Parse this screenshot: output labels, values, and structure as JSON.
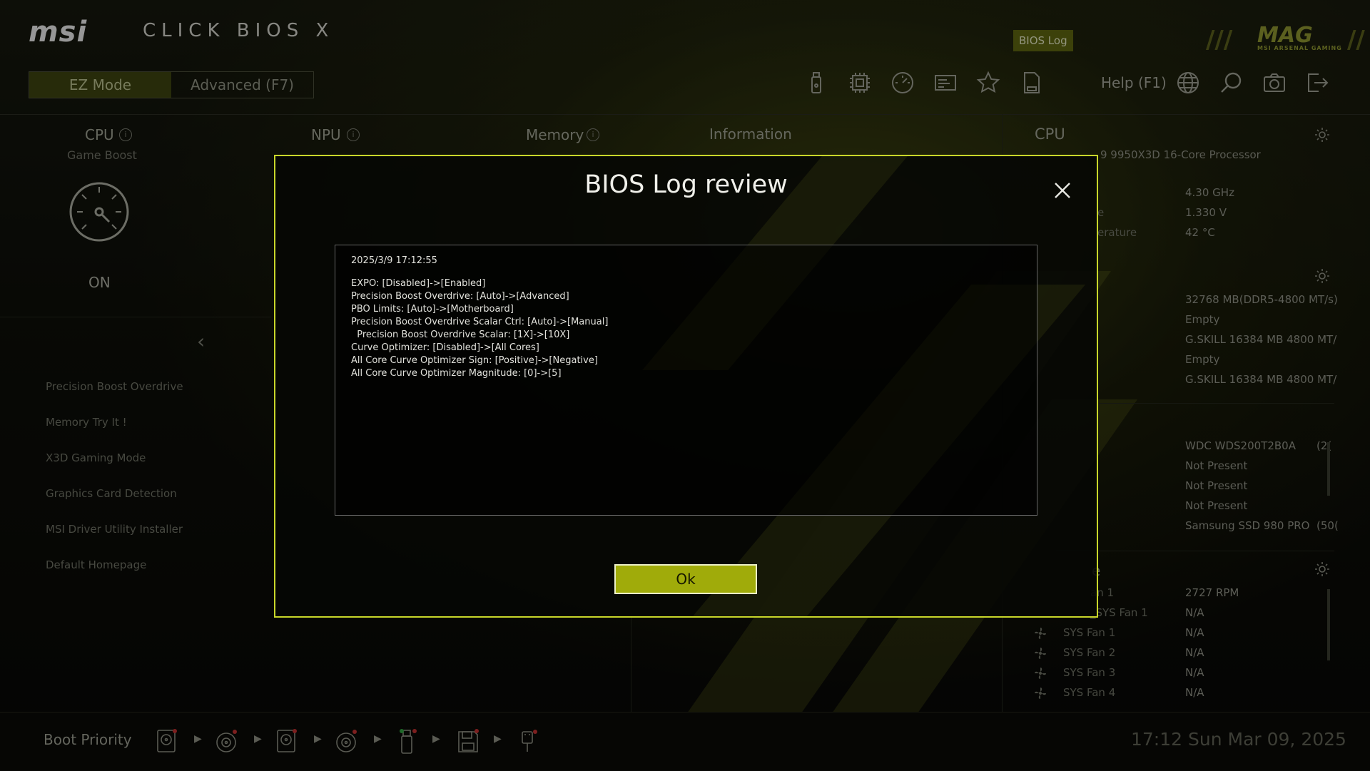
{
  "brand": {
    "logo": "msi",
    "product": "CLICK BIOS X",
    "mag_logo": "MAG",
    "mag_tag": "MSI ARSENAL GAMING"
  },
  "header": {
    "bios_log_label": "BIOS Log",
    "mode_tabs": [
      "EZ Mode",
      "Advanced (F7)"
    ],
    "active_mode": "EZ Mode",
    "help_label": "Help (F1)",
    "toolbar_icons": [
      "usb-drive-icon",
      "cpu-chip-icon",
      "oc-gauge-icon",
      "hardware-monitor-icon",
      "favorites-star-icon",
      "log-file-icon",
      "language-globe-icon",
      "search-icon",
      "screenshot-camera-icon",
      "exit-icon"
    ]
  },
  "left": {
    "cpu_title": "CPU",
    "cpu_sub": "Game Boost",
    "game_boost_state": "ON",
    "npu_title": "NPU",
    "memory_title": "Memory",
    "information_title": "Information",
    "menu": [
      "Precision Boost Overdrive",
      "Memory Try It !",
      "X3D Gaming Mode",
      "Graphics Card Detection",
      "MSI Driver Utility Installer",
      "Default Homepage"
    ]
  },
  "right": {
    "cpu_title": "CPU",
    "cpu_name": "9 9950X3D 16-Core Processor",
    "cpu_rows": [
      {
        "label": "",
        "value": "4.30 GHz"
      },
      {
        "label": "e",
        "value": "1.330 V"
      },
      {
        "label": "erature",
        "value": "42 °C"
      }
    ],
    "memory_rows": [
      {
        "label": "",
        "value": "32768 MB(DDR5-4800 MT/s)"
      },
      {
        "label": "",
        "value": "Empty"
      },
      {
        "label": "",
        "value": "G.SKILL 16384 MB 4800 MT/"
      },
      {
        "label": "",
        "value": "Empty"
      },
      {
        "label": "",
        "value": "G.SKILL 16384 MB 4800 MT/"
      }
    ],
    "storage_rows": [
      {
        "value": "WDC WDS200T2B0A",
        "extra": "(2("
      },
      {
        "value": "Not Present",
        "extra": ""
      },
      {
        "value": "Not Present",
        "extra": ""
      },
      {
        "value": "Not Present",
        "extra": ""
      },
      {
        "value": "Samsung SSD 980 PRO",
        "extra": "(50("
      }
    ],
    "fan_title": "e",
    "fans": [
      {
        "label": "an 1",
        "value": "2727 RPM"
      },
      {
        "label": "_SYS Fan 1",
        "value": "N/A"
      },
      {
        "label": "SYS Fan 1",
        "value": "N/A"
      },
      {
        "label": "SYS Fan 2",
        "value": "N/A"
      },
      {
        "label": "SYS Fan 3",
        "value": "N/A"
      },
      {
        "label": "SYS Fan 4",
        "value": "N/A"
      }
    ]
  },
  "footer": {
    "boot_priority_label": "Boot Priority",
    "boot_devices": [
      "hdd-icon",
      "optical-drive-icon",
      "hdd-icon",
      "optical-drive-icon",
      "usb-key-icon",
      "floppy-disk-icon",
      "usb-plug-icon"
    ],
    "clock": "17:12  Sun Mar 09, 2025"
  },
  "modal": {
    "title": "BIOS Log review",
    "timestamp": "2025/3/9 17:12:55",
    "lines": [
      "EXPO: [Disabled]->[Enabled]",
      "Precision Boost Overdrive: [Auto]->[Advanced]",
      "PBO Limits: [Auto]->[Motherboard]",
      "Precision Boost Overdrive Scalar Ctrl: [Auto]->[Manual]",
      "  Precision Boost Overdrive Scalar: [1X]->[10X]",
      "Curve Optimizer: [Disabled]->[All Cores]",
      "All Core Curve Optimizer Sign: [Positive]->[Negative]",
      "All Core Curve Optimizer Magnitude: [0]->[5]"
    ],
    "ok_label": "Ok"
  },
  "colors": {
    "accent": "#c8d62a",
    "ok_button": "#a0ab0a",
    "active_tab": "#3c4210"
  }
}
